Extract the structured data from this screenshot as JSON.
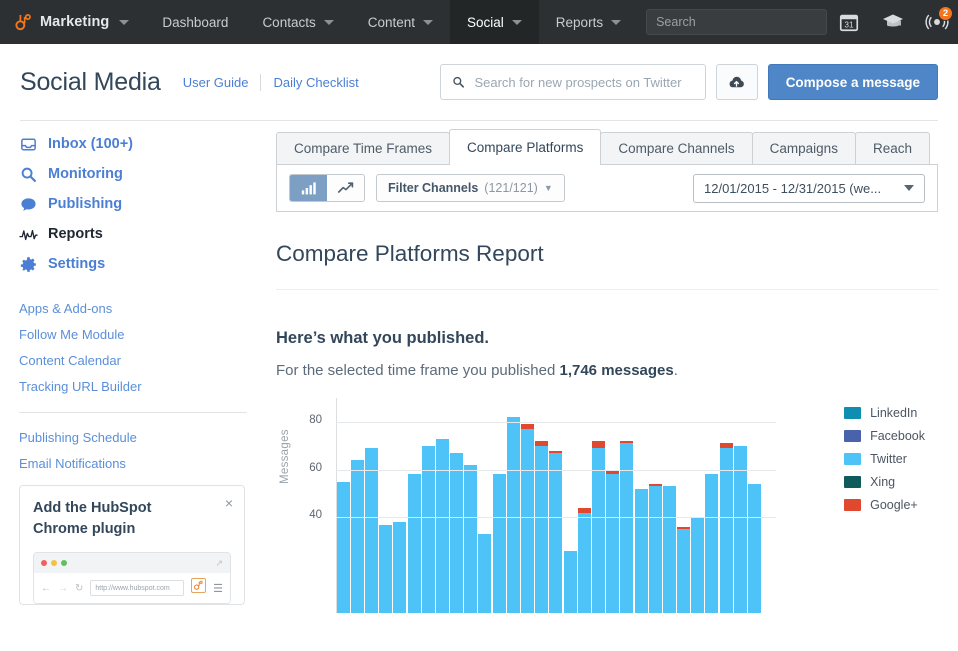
{
  "topnav": {
    "brand": "Marketing",
    "items": [
      {
        "label": "Dashboard",
        "caret": false,
        "active": false
      },
      {
        "label": "Contacts",
        "caret": true,
        "active": false
      },
      {
        "label": "Content",
        "caret": true,
        "active": false
      },
      {
        "label": "Social",
        "caret": true,
        "active": true
      },
      {
        "label": "Reports",
        "caret": true,
        "active": false
      }
    ],
    "search_placeholder": "Search",
    "search_value": "",
    "icons": [
      "calendar-icon",
      "graduation-cap-icon",
      "notifications-icon"
    ],
    "calendar_day": "31",
    "notification_count": "2",
    "bg_color": "#2d3032",
    "brand_color": "#f5761a"
  },
  "header": {
    "title": "Social Media",
    "links": [
      "User Guide",
      "Daily Checklist"
    ],
    "search_placeholder": "Search for new prospects on Twitter",
    "search_value": "",
    "upload_icon": "cloud-upload-icon",
    "compose_label": "Compose a message",
    "compose_color": "#4e86c7"
  },
  "sidebar": {
    "nav": [
      {
        "label": "Inbox (100+)",
        "icon": "inbox-icon",
        "active": false
      },
      {
        "label": "Monitoring",
        "icon": "search-icon",
        "active": false
      },
      {
        "label": "Publishing",
        "icon": "speech-bubble-icon",
        "active": false
      },
      {
        "label": "Reports",
        "icon": "activity-pulse-icon",
        "active": true
      },
      {
        "label": "Settings",
        "icon": "gear-icon",
        "active": false
      }
    ],
    "links_group1": [
      "Apps & Add-ons",
      "Follow Me Module",
      "Content Calendar",
      "Tracking URL Builder"
    ],
    "links_group2": [
      "Publishing Schedule",
      "Email Notifications"
    ],
    "promo": {
      "title": "Add the HubSpot Chrome plugin",
      "close": "×",
      "url": "http://www.hubspot.com"
    }
  },
  "main": {
    "tabs": [
      {
        "label": "Compare Time Frames",
        "active": false
      },
      {
        "label": "Compare Platforms",
        "active": true
      },
      {
        "label": "Compare Channels",
        "active": false
      },
      {
        "label": "Campaigns",
        "active": false
      },
      {
        "label": "Reach",
        "active": false
      }
    ],
    "toolbar": {
      "chart_type_bar": "bar-chart-icon",
      "chart_type_line": "line-chart-icon",
      "active_chart_type": "bar",
      "filter_label": "Filter Channels",
      "filter_count": "(121/121)",
      "filter_caret": "▼",
      "date_range": "12/01/2015 - 12/31/2015 (we..."
    },
    "report_title": "Compare Platforms Report",
    "section_heading": "Here’s what you published.",
    "section_text_before": "For the selected time frame you published ",
    "section_text_bold": "1,746 messages",
    "section_text_after": "."
  },
  "chart_data": {
    "type": "bar",
    "stacked": true,
    "title": "",
    "xlabel": "",
    "ylabel": "Messages",
    "ylim": [
      0,
      90
    ],
    "yticks": [
      40,
      60,
      80
    ],
    "grid": true,
    "legend_position": "right",
    "series": [
      {
        "name": "LinkedIn",
        "color": "#0e8eb0",
        "values": [
          0,
          0,
          0,
          0,
          0,
          0,
          0,
          0,
          0,
          0,
          0,
          0,
          0,
          0,
          0,
          0,
          0,
          0,
          0,
          0,
          0,
          0,
          0,
          0,
          0,
          0,
          0,
          0,
          0,
          0,
          0
        ]
      },
      {
        "name": "Facebook",
        "color": "#4a62ab",
        "values": [
          0,
          0,
          0,
          0,
          0,
          0,
          0,
          0,
          0,
          0,
          0,
          0,
          0,
          0,
          0,
          0,
          0,
          0,
          0,
          0,
          0,
          0,
          0,
          0,
          0,
          0,
          0,
          0,
          0,
          0,
          0
        ]
      },
      {
        "name": "Twitter",
        "color": "#4ec3f7",
        "values": [
          55,
          64,
          69,
          37,
          38,
          58,
          70,
          73,
          67,
          62,
          33,
          58,
          82,
          77,
          70,
          67,
          26,
          42,
          69,
          58,
          71,
          52,
          53,
          53,
          35,
          40,
          58,
          69,
          70,
          54,
          0
        ]
      },
      {
        "name": "Xing",
        "color": "#0f5b5b",
        "values": [
          0,
          0,
          0,
          0,
          0,
          0,
          0,
          0,
          0,
          0,
          0,
          0,
          0,
          0,
          0,
          0,
          0,
          0,
          0,
          0,
          0,
          0,
          0,
          0,
          0,
          0,
          0,
          0,
          0,
          0,
          0
        ]
      },
      {
        "name": "Google+",
        "color": "#e0492f",
        "values": [
          0,
          0,
          0,
          0,
          0,
          0,
          0,
          0,
          0,
          0,
          0,
          0,
          0,
          2,
          2,
          1,
          0,
          2,
          3,
          2,
          1,
          0,
          1,
          0,
          1,
          0,
          0,
          2,
          0,
          0,
          0
        ]
      }
    ]
  }
}
